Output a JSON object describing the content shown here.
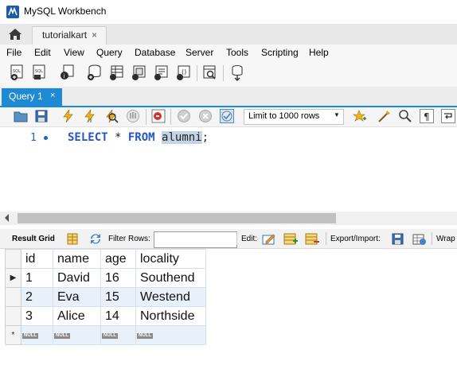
{
  "window": {
    "title": "MySQL Workbench"
  },
  "connection_tab": {
    "label": "tutorialkart",
    "close": "×"
  },
  "menu": [
    "File",
    "Edit",
    "View",
    "Query",
    "Database",
    "Server",
    "Tools",
    "Scripting",
    "Help"
  ],
  "query_tab": {
    "label": "Query 1",
    "close": "×"
  },
  "sql_toolbar": {
    "limit_label": "Limit to 1000 rows",
    "caret": "▼"
  },
  "editor": {
    "line_number": "1",
    "kw_select": "SELECT",
    "star": " * ",
    "kw_from": "FROM",
    "space": " ",
    "table_name": "alumni",
    "semicolon": ";"
  },
  "result_toolbar": {
    "result_grid": "Result Grid",
    "filter_rows": "Filter Rows:",
    "edit": "Edit:",
    "export_import": "Export/Import:",
    "wrap": "Wrap"
  },
  "grid": {
    "columns": [
      "id",
      "name",
      "age",
      "locality"
    ],
    "rows": [
      [
        "1",
        "David",
        "16",
        "Southend"
      ],
      [
        "2",
        "Eva",
        "15",
        "Westend"
      ],
      [
        "3",
        "Alice",
        "14",
        "Northside"
      ]
    ],
    "current_row_marker": "▶",
    "new_row_marker": "*",
    "null_label": "NULL"
  },
  "colors": {
    "accent": "#1e8ad6",
    "keyword": "#2655c4",
    "selection": "#c5d4e4",
    "grid_alt": "#e8f0fa"
  }
}
